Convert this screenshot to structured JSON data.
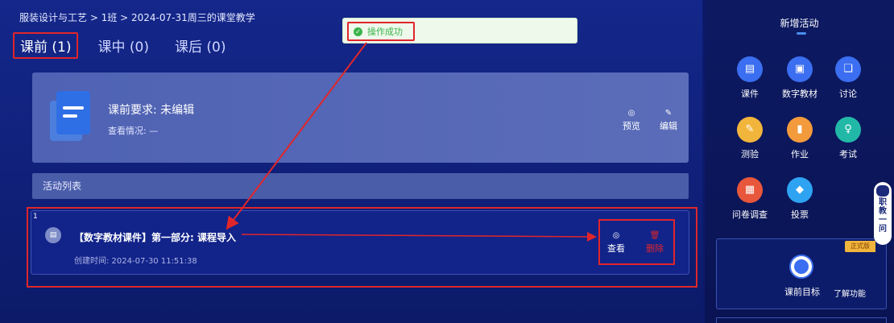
{
  "breadcrumb": "服装设计与工艺 > 1班 > 2024-07-31周三的课堂教学",
  "tabs": [
    {
      "label": "课前 (1)",
      "active": true
    },
    {
      "label": "课中 (0)",
      "active": false
    },
    {
      "label": "课后 (0)",
      "active": false
    }
  ],
  "toast": {
    "text": "操作成功",
    "icon": "check-circle-icon"
  },
  "card": {
    "title": "课前要求: 未编辑",
    "subtitle": "查看情况: —",
    "actions": [
      {
        "label": "预览",
        "icon": "eye-icon"
      },
      {
        "label": "编辑",
        "icon": "pen-icon"
      }
    ]
  },
  "section": {
    "title": "活动列表"
  },
  "activity": {
    "index": "1",
    "title": "【数字教材课件】第一部分: 课程导入",
    "time": "创建时间: 2024-07-30 11:51:38",
    "view_label": "查看",
    "delete_label": "删除"
  },
  "right_panel": {
    "title": "新增活动",
    "tools": [
      {
        "label": "课件",
        "icon": "courseware-icon",
        "color": "#3b6ef0"
      },
      {
        "label": "数字教材",
        "icon": "digital-book-icon",
        "color": "#3b6ef0"
      },
      {
        "label": "讨论",
        "icon": "chat-icon",
        "color": "#3b6ef0"
      },
      {
        "label": "测验",
        "icon": "quiz-icon",
        "color": "#f2b53c"
      },
      {
        "label": "作业",
        "icon": "book-icon",
        "color": "#f29a3c"
      },
      {
        "label": "考试",
        "icon": "exam-icon",
        "color": "#22b8a8"
      },
      {
        "label": "问卷调查",
        "icon": "survey-icon",
        "color": "#e8563c"
      },
      {
        "label": "投票",
        "icon": "vote-icon",
        "color": "#2ea3f2"
      }
    ],
    "goal_label": "课前目标",
    "goal_link": "了解功能",
    "formal_tag": "正式版",
    "float_bar": "职教一问"
  },
  "colors": {
    "accent_red": "#e0262a",
    "success_green": "#3bb34a",
    "delete_red": "#e0262a"
  }
}
